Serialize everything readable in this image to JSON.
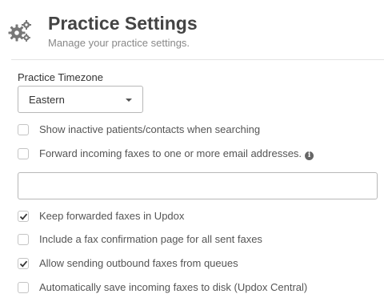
{
  "header": {
    "title": "Practice Settings",
    "subtitle": "Manage your practice settings.",
    "icon": "gears-icon"
  },
  "timezone": {
    "label": "Practice Timezone",
    "selected": "Eastern"
  },
  "email_forward_input": {
    "value": "",
    "placeholder": ""
  },
  "options": [
    {
      "label": "Show inactive patients/contacts when searching",
      "checked": false
    },
    {
      "label": "Forward incoming faxes to one or more email addresses.",
      "checked": false,
      "info_icon": "info-icon"
    },
    {
      "label": "Keep forwarded faxes in Updox",
      "checked": true
    },
    {
      "label": "Include a fax confirmation page for all sent faxes",
      "checked": false
    },
    {
      "label": "Allow sending outbound faxes from queues",
      "checked": true
    },
    {
      "label": "Automatically save incoming faxes to disk (Updox Central)",
      "checked": false
    }
  ],
  "colors": {
    "title": "#444444",
    "subtitle": "#888888",
    "checkbox_border": "#c4c4c4",
    "checkmark": "#333333",
    "icon": "#777777"
  }
}
